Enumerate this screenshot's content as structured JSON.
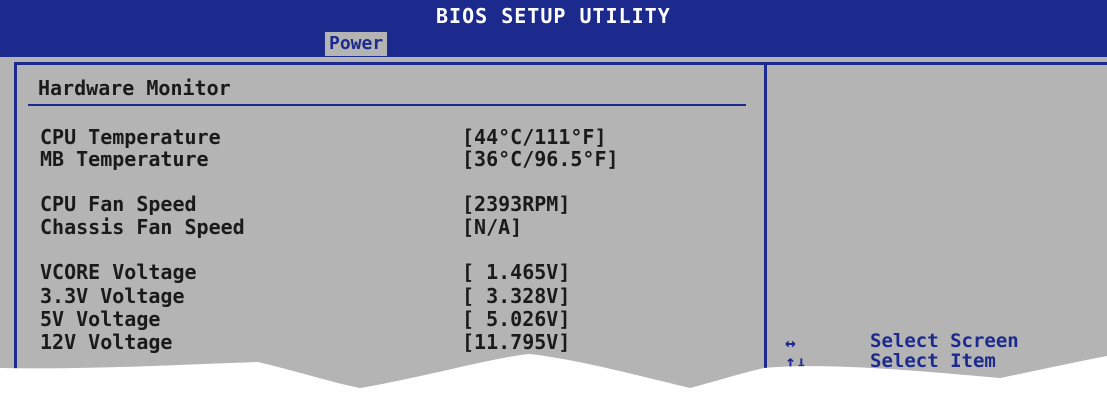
{
  "header": {
    "title": "BIOS SETUP UTILITY",
    "active_tab": "Power"
  },
  "panel": {
    "title": "Hardware Monitor"
  },
  "monitor": {
    "rows": [
      {
        "label": "CPU Temperature",
        "value": "[44°C/111°F]"
      },
      {
        "label": "MB Temperature",
        "value": "[36°C/96.5°F]"
      },
      {
        "label": "CPU Fan Speed",
        "value": "[2393RPM]"
      },
      {
        "label": "Chassis Fan Speed",
        "value": "[N/A]"
      },
      {
        "label": "VCORE Voltage",
        "value": "[ 1.465V]"
      },
      {
        "label": "3.3V Voltage",
        "value": "[ 3.328V]"
      },
      {
        "label": "5V Voltage",
        "value": "[ 5.026V]"
      },
      {
        "label": "12V Voltage",
        "value": "[11.795V]"
      }
    ]
  },
  "help": {
    "select_screen": "Select Screen",
    "select_item": "Select Item",
    "arrows_lr": "↔",
    "arrows_ud": "↑↓"
  },
  "colors": {
    "accent": "#1c2a8e",
    "background": "#b4b4b4"
  }
}
